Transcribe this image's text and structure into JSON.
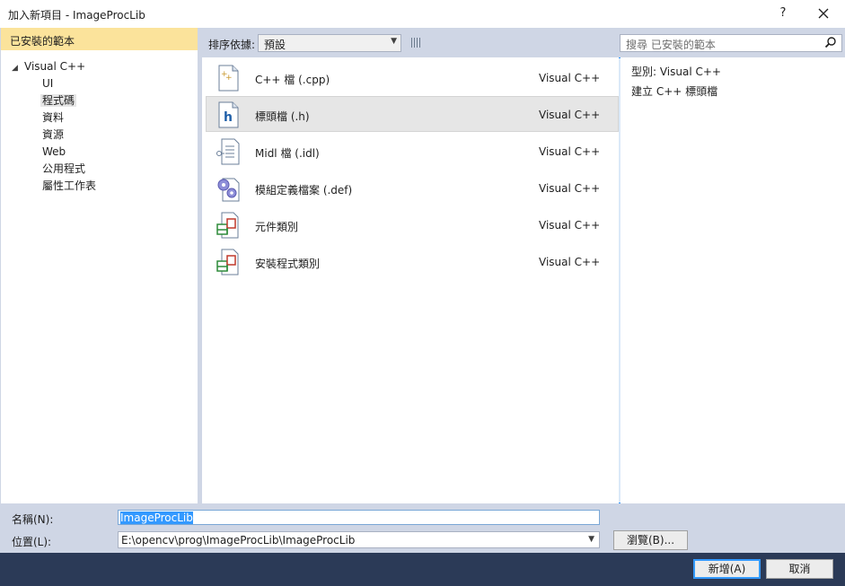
{
  "window": {
    "title": "加入新項目 - ImageProcLib",
    "help_label": "?",
    "close_label": "✕"
  },
  "left": {
    "header": "已安裝的範本",
    "tree": {
      "root": "Visual C++",
      "children": [
        "UI",
        "程式碼",
        "資料",
        "資源",
        "Web",
        "公用程式",
        "屬性工作表"
      ],
      "selected": "程式碼"
    }
  },
  "toolbar": {
    "sort_label": "排序依據:",
    "sort_value": "預設",
    "search_placeholder": "搜尋 已安裝的範本"
  },
  "templates": [
    {
      "name": "C++ 檔 (.cpp)",
      "lang": "Visual C++",
      "icon": "cpp-file-icon"
    },
    {
      "name": "標頭檔 (.h)",
      "lang": "Visual C++",
      "icon": "header-file-icon"
    },
    {
      "name": "Midl 檔 (.idl)",
      "lang": "Visual C++",
      "icon": "midl-file-icon"
    },
    {
      "name": "模組定義檔案 (.def)",
      "lang": "Visual C++",
      "icon": "module-definition-icon"
    },
    {
      "name": "元件類別",
      "lang": "Visual C++",
      "icon": "component-class-icon"
    },
    {
      "name": "安裝程式類別",
      "lang": "Visual C++",
      "icon": "installer-class-icon"
    }
  ],
  "info": {
    "type_line": "型別:  Visual C++",
    "description": "建立 C++ 標頭檔"
  },
  "fields": {
    "name_label": "名稱(N):",
    "name_value": "ImageProcLib",
    "location_label": "位置(L):",
    "location_value": "E:\\opencv\\prog\\ImageProcLib\\ImageProcLib",
    "browse_label": "瀏覽(B)..."
  },
  "buttons": {
    "add": "新增(A)",
    "cancel": "取消"
  },
  "colors": {
    "selected_header": "#fbe39b",
    "frame": "#cfd6e5",
    "button_strip": "#2b3a57",
    "selection_blue": "#3399ff"
  }
}
